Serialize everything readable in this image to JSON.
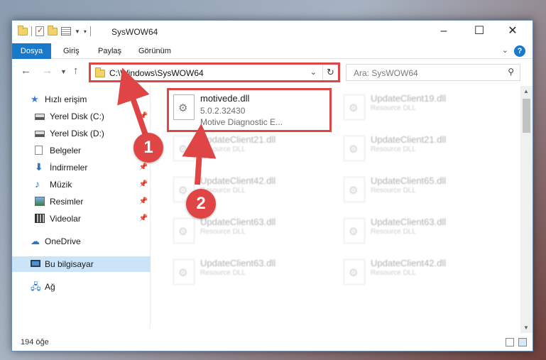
{
  "title": "SysWOW64",
  "ribbon": {
    "tabs": [
      {
        "label": "Dosya"
      },
      {
        "label": "Giriş"
      },
      {
        "label": "Paylaş"
      },
      {
        "label": "Görünüm"
      }
    ],
    "accent_color": "#1979ca"
  },
  "nav": {
    "address": "C:\\Windows\\SysWOW64",
    "search_placeholder": "Ara: SysWOW64"
  },
  "sidebar": {
    "items": [
      {
        "label": "Hızlı erişim",
        "icon": "star-icon"
      },
      {
        "label": "Yerel Disk (C:)",
        "icon": "disk-icon"
      },
      {
        "label": "Yerel Disk (D:)",
        "icon": "disk-icon"
      },
      {
        "label": "Belgeler",
        "icon": "document-icon"
      },
      {
        "label": "İndirmeler",
        "icon": "download-icon"
      },
      {
        "label": "Müzik",
        "icon": "music-icon"
      },
      {
        "label": "Resimler",
        "icon": "pictures-icon"
      },
      {
        "label": "Videolar",
        "icon": "video-icon"
      },
      {
        "label": "OneDrive",
        "icon": "cloud-icon"
      },
      {
        "label": "Bu bilgisayar",
        "icon": "computer-icon"
      },
      {
        "label": "Ağ",
        "icon": "network-icon"
      }
    ]
  },
  "files": {
    "highlighted": {
      "name": "motivede.dll",
      "version": "5.0.2.32430",
      "description": "Motive Diagnostic E..."
    },
    "faded": [
      {
        "name": "UpdateClient19.dll",
        "type": "Resource DLL"
      },
      {
        "name": "UpdateClient21.dll",
        "type": "Resource DLL"
      },
      {
        "name": "UpdateClient21.dll",
        "type": "Resource DLL"
      },
      {
        "name": "UpdateClient42.dll",
        "type": "Resource DLL"
      },
      {
        "name": "UpdateClient65.dll",
        "type": "Resource DLL"
      },
      {
        "name": "UpdateClient63.dll",
        "type": "Resource DLL"
      },
      {
        "name": "UpdateClient63.dll",
        "type": "Resource DLL"
      },
      {
        "name": "UpdateClient63.dll",
        "type": "Resource DLL"
      },
      {
        "name": "UpdateClient42.dll",
        "type": "Resource DLL"
      }
    ]
  },
  "status": {
    "item_count": "194 öğe"
  },
  "annotations": {
    "step1": "1",
    "step2": "2",
    "color": "#e04545"
  }
}
